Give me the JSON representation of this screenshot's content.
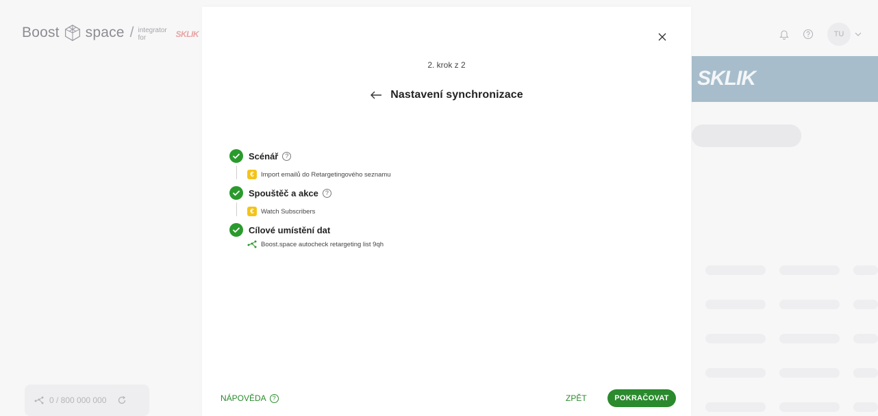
{
  "app": {
    "logo_word_1": "Boost",
    "logo_word_2": "space",
    "logo_slash": "/",
    "integrator_label": "integrator for",
    "partner_logo": "SKLIK",
    "operations": "0 / 800 000 000",
    "user_initials": "TU",
    "banner_logo": "SKLIK"
  },
  "modal": {
    "step_counter": "2. krok z 2",
    "title": "Nastavení synchronizace",
    "steps": [
      {
        "label": "Scénář",
        "has_help": true,
        "detail": "Import emailů do Retargetingového seznamu",
        "detail_icon": "app-icon"
      },
      {
        "label": "Spouštěč a akce",
        "has_help": true,
        "detail": "Watch Subscribers",
        "detail_icon": "app-icon"
      },
      {
        "label": "Cílové umístění dat",
        "has_help": false,
        "detail": "Boost.space autocheck retargeting list 9qh",
        "detail_icon": "boost-space-icon"
      }
    ],
    "footer": {
      "help_label": "NÁPOVĚDA",
      "back_label": "ZPĚT",
      "continue_label": "POKRAČOVAT"
    }
  },
  "colors": {
    "accent_green": "#2a8a2d",
    "check_green": "#2a9a2d",
    "app_icon_yellow": "#f4c31a",
    "banner": "#a7bdcb"
  }
}
